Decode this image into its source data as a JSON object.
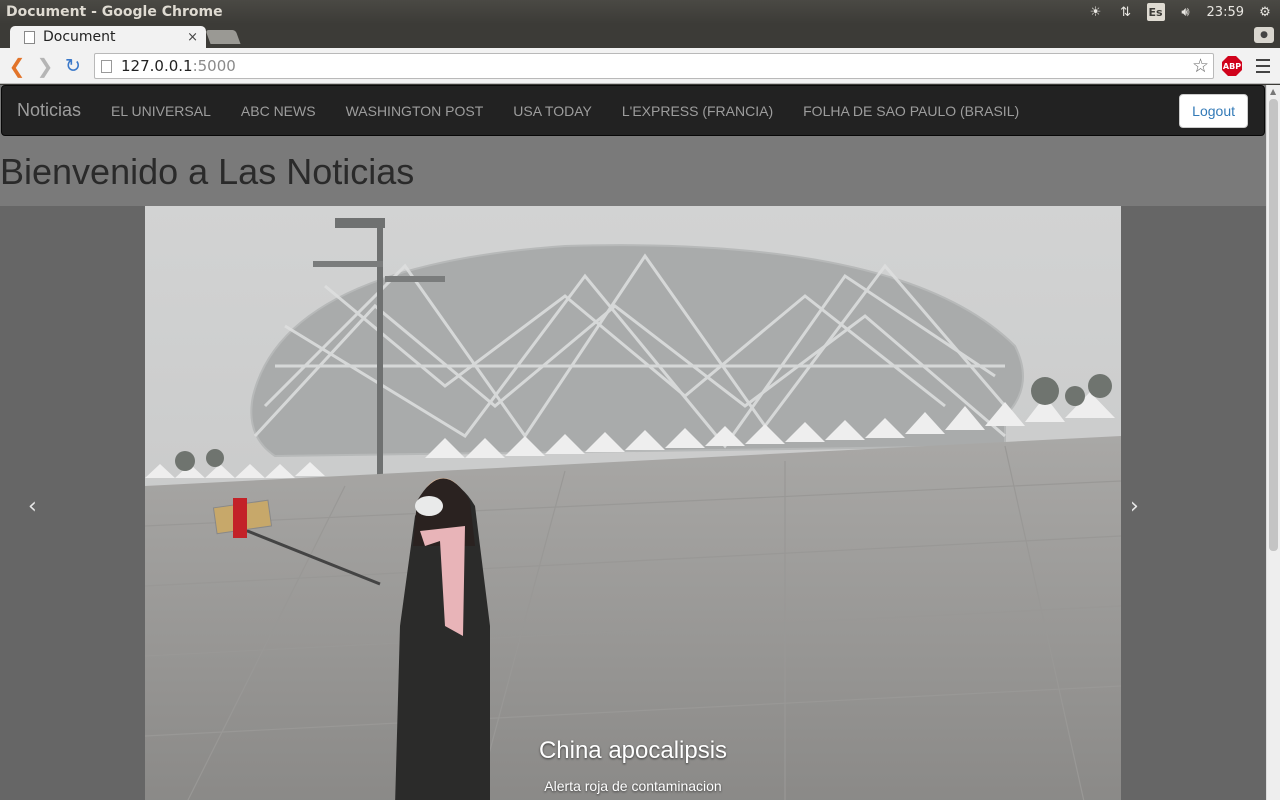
{
  "os": {
    "window_title": "Document - Google Chrome",
    "lang": "Es",
    "time": "23:59"
  },
  "browser": {
    "tab_title": "Document",
    "url_host": "127.0.0.1",
    "url_port": ":5000",
    "abp_label": "ABP"
  },
  "navbar": {
    "brand": "Noticias",
    "links": [
      "EL UNIVERSAL",
      "ABC NEWS",
      "WASHINGTON POST",
      "USA TODAY",
      "L'EXPRESS (FRANCIA)",
      "FOLHA DE SAO PAULO (BRASIL)"
    ],
    "logout": "Logout"
  },
  "page": {
    "heading": "Bienvenido a Las Noticias"
  },
  "carousel": {
    "prev": "‹",
    "next": "›",
    "caption_title": "China apocalipsis",
    "caption_text": "Alerta roja de contaminacion"
  }
}
